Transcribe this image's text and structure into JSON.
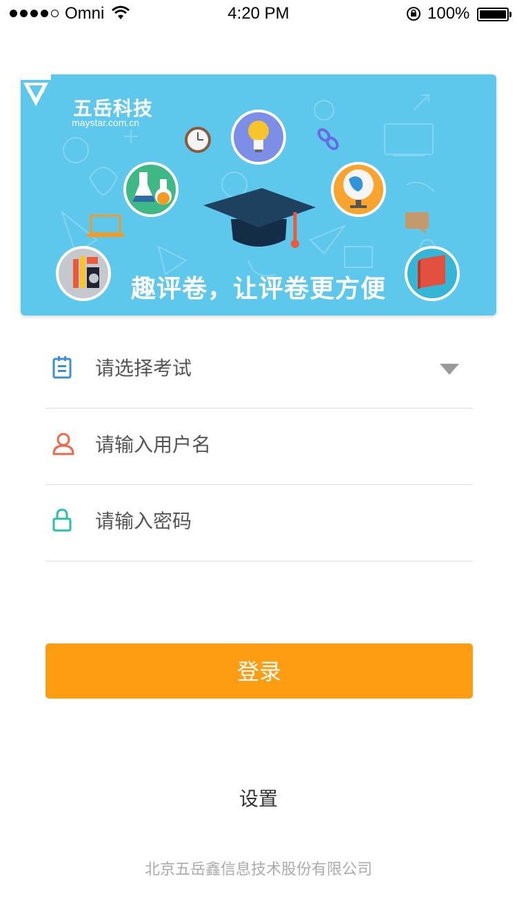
{
  "status_bar": {
    "carrier": "Omni",
    "time": "4:20 PM",
    "battery": "100%"
  },
  "banner": {
    "logo_text": "五岳科技",
    "logo_url": "maystar.com.cn",
    "slogan": "趣评卷，让评卷更方便",
    "icons": [
      "clock-icon",
      "lightbulb-icon",
      "flask-icon",
      "globe-icon",
      "graduation-cap-icon",
      "ruler-icon",
      "book-icon",
      "laptop-icon",
      "chat-bubble-icon",
      "link-icon"
    ]
  },
  "form": {
    "exam_placeholder": "请选择考试",
    "username_placeholder": "请输入用户名",
    "password_placeholder": "请输入密码"
  },
  "colors": {
    "accent": "#ff9d12",
    "banner_bg": "#5ec8ec",
    "exam_icon": "#3a8fd6",
    "user_icon": "#f0684a",
    "lock_icon": "#2bbfa4"
  },
  "login_label": "登录",
  "settings_label": "设置",
  "footer": "北京五岳鑫信息技术股份有限公司"
}
